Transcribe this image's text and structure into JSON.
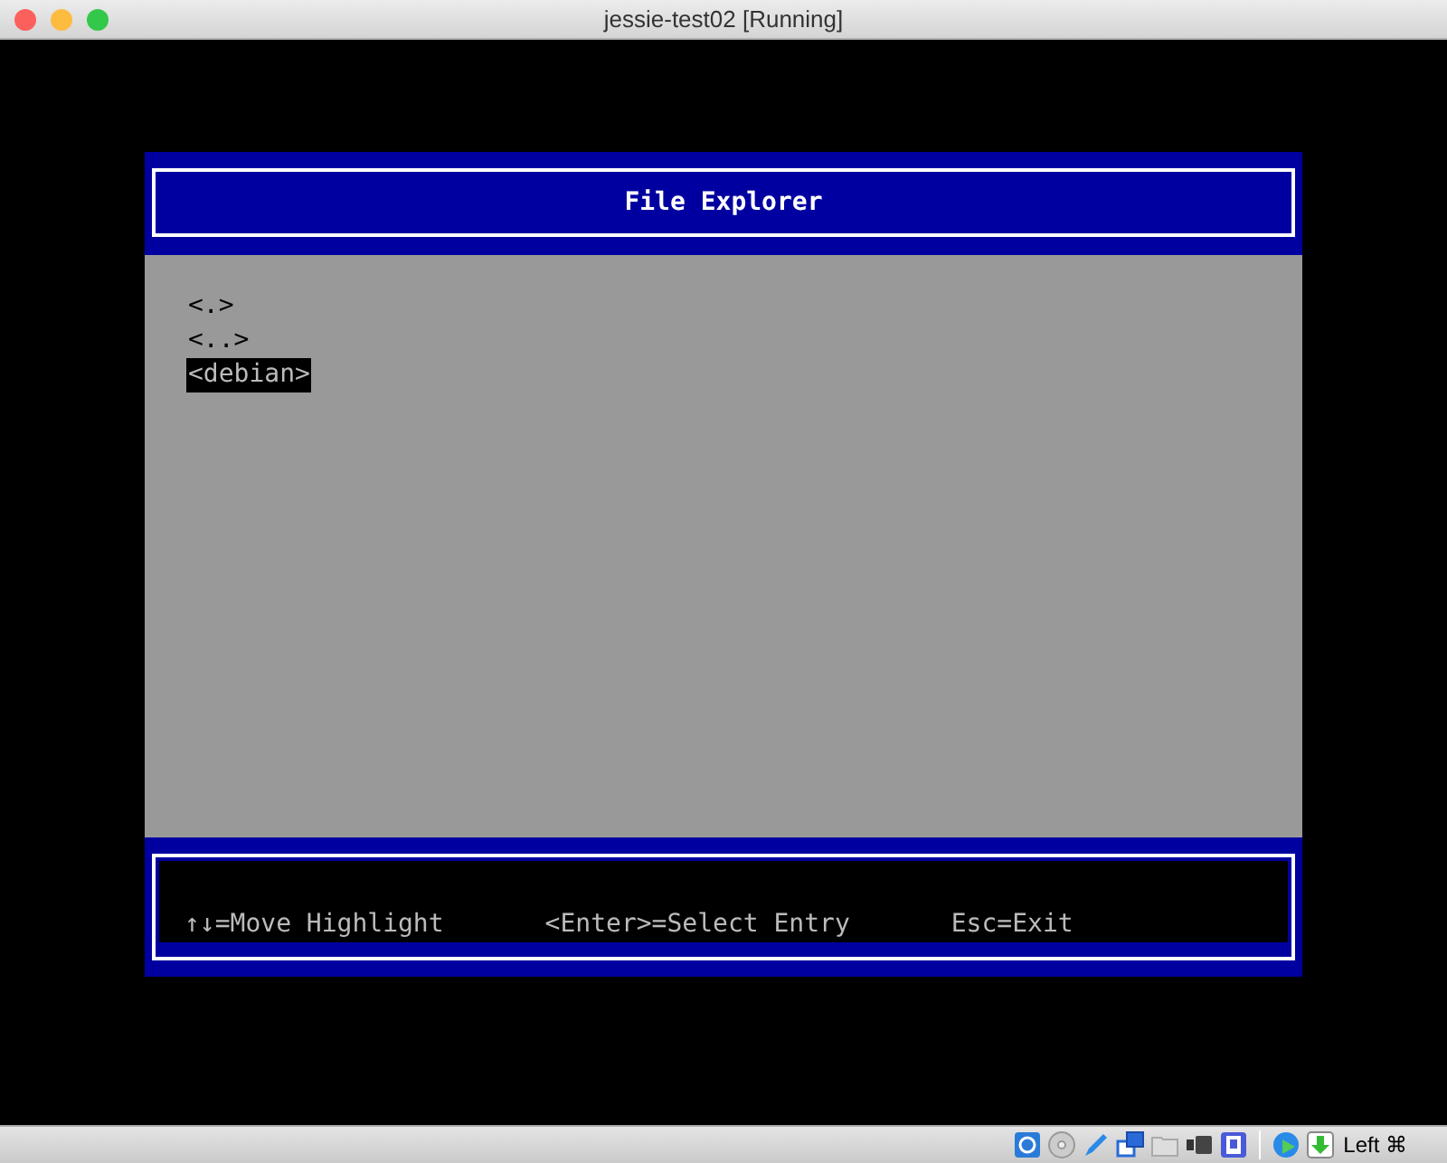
{
  "window": {
    "title": "jessie-test02 [Running]"
  },
  "dialog": {
    "title": "File Explorer",
    "entries": [
      {
        "label": "<.>",
        "selected": false
      },
      {
        "label": "<..>",
        "selected": false
      },
      {
        "label": "<debian>",
        "selected": true
      }
    ],
    "hints": [
      "↑↓=Move Highlight",
      "<Enter>=Select Entry",
      "Esc=Exit"
    ]
  },
  "status_bar": {
    "host_key": "Left ⌘"
  }
}
